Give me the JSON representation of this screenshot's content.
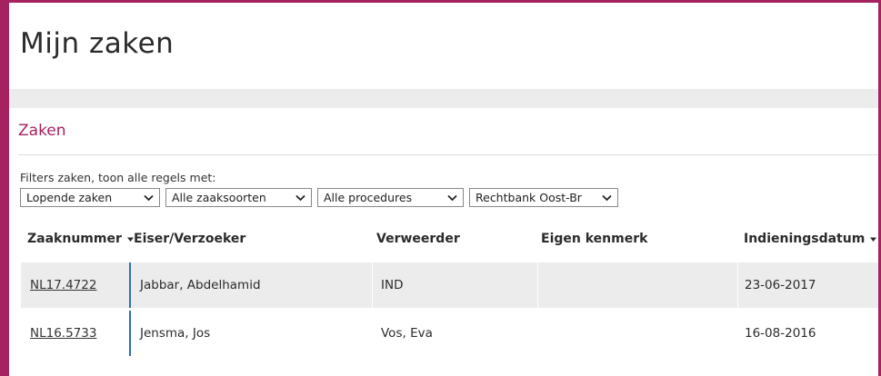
{
  "page": {
    "title": "Mijn zaken",
    "section_title": "Zaken"
  },
  "filters": {
    "label": "Filters zaken, toon alle regels met:",
    "selects": [
      {
        "value": "Lopende zaken"
      },
      {
        "value": "Alle zaaksoorten"
      },
      {
        "value": "Alle procedures"
      },
      {
        "value": "Rechtbank Oost-Br"
      }
    ]
  },
  "table": {
    "columns": [
      {
        "label": "Zaaknummer",
        "sortable": true
      },
      {
        "label": "Eiser/Verzoeker",
        "sortable": false
      },
      {
        "label": "Verweerder",
        "sortable": false
      },
      {
        "label": "Eigen kenmerk",
        "sortable": false
      },
      {
        "label": "Indieningsdatum",
        "sortable": true
      }
    ],
    "rows": [
      {
        "zaaknummer": "NL17.4722",
        "eiser": "Jabbar, Abdelhamid",
        "verweerder": "IND",
        "kenmerk": "",
        "datum": "23-06-2017"
      },
      {
        "zaaknummer": "NL16.5733",
        "eiser": "Jensma, Jos",
        "verweerder": "Vos, Eva",
        "kenmerk": "",
        "datum": "16-08-2016"
      }
    ]
  },
  "colors": {
    "accent": "#a5215f",
    "row_shade": "#ececec",
    "divider_blue": "#2e6fb0"
  },
  "icons": {
    "select_arrow": "chevron-down-icon",
    "sort": "sort-caret-icon"
  }
}
